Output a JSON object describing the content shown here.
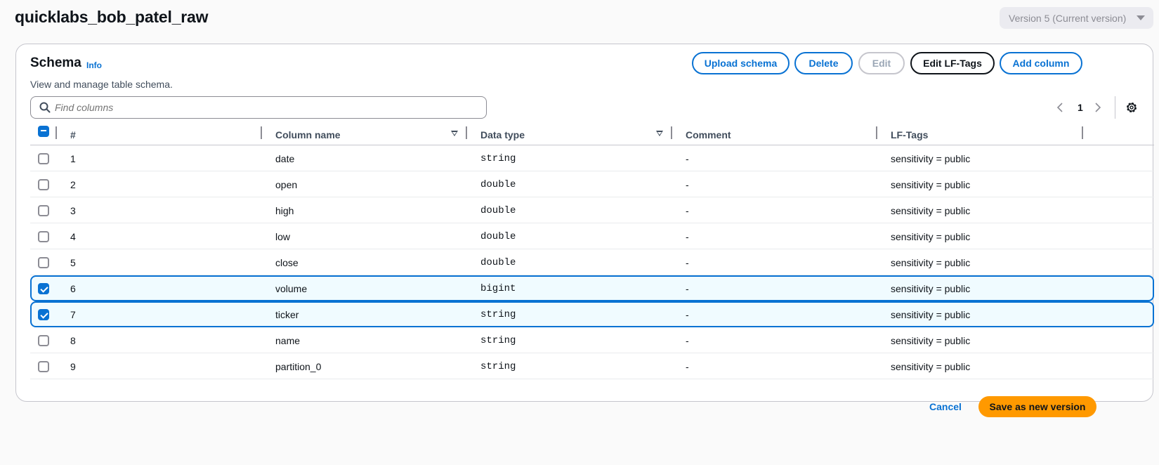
{
  "page": {
    "title": "quicklabs_bob_patel_raw",
    "version_select": "Version 5 (Current version)"
  },
  "schema": {
    "title": "Schema",
    "info": "Info",
    "description": "View and manage table schema.",
    "buttons": {
      "upload": "Upload schema",
      "delete": "Delete",
      "edit": "Edit",
      "edit_lf_tags": "Edit LF-Tags",
      "add_column": "Add column"
    },
    "search": {
      "placeholder": "Find columns",
      "value": ""
    },
    "pagination": {
      "current_page": "1"
    }
  },
  "table": {
    "headers": {
      "num": "#",
      "column_name": "Column name",
      "data_type": "Data type",
      "comment": "Comment",
      "lf_tags": "LF-Tags"
    },
    "rows": [
      {
        "num": "1",
        "name": "date",
        "type": "string",
        "comment": "-",
        "tags": "sensitivity = public",
        "selected": false
      },
      {
        "num": "2",
        "name": "open",
        "type": "double",
        "comment": "-",
        "tags": "sensitivity = public",
        "selected": false
      },
      {
        "num": "3",
        "name": "high",
        "type": "double",
        "comment": "-",
        "tags": "sensitivity = public",
        "selected": false
      },
      {
        "num": "4",
        "name": "low",
        "type": "double",
        "comment": "-",
        "tags": "sensitivity = public",
        "selected": false
      },
      {
        "num": "5",
        "name": "close",
        "type": "double",
        "comment": "-",
        "tags": "sensitivity = public",
        "selected": false
      },
      {
        "num": "6",
        "name": "volume",
        "type": "bigint",
        "comment": "-",
        "tags": "sensitivity = public",
        "selected": true
      },
      {
        "num": "7",
        "name": "ticker",
        "type": "string",
        "comment": "-",
        "tags": "sensitivity = public",
        "selected": true
      },
      {
        "num": "8",
        "name": "name",
        "type": "string",
        "comment": "-",
        "tags": "sensitivity = public",
        "selected": false
      },
      {
        "num": "9",
        "name": "partition_0",
        "type": "string",
        "comment": "-",
        "tags": "sensitivity = public",
        "selected": false
      }
    ]
  },
  "footer": {
    "cancel": "Cancel",
    "save": "Save as new version"
  },
  "colors": {
    "accent": "#0972d3",
    "primary_button": "#ff9900",
    "selected_row_bg": "#f0fbff"
  }
}
